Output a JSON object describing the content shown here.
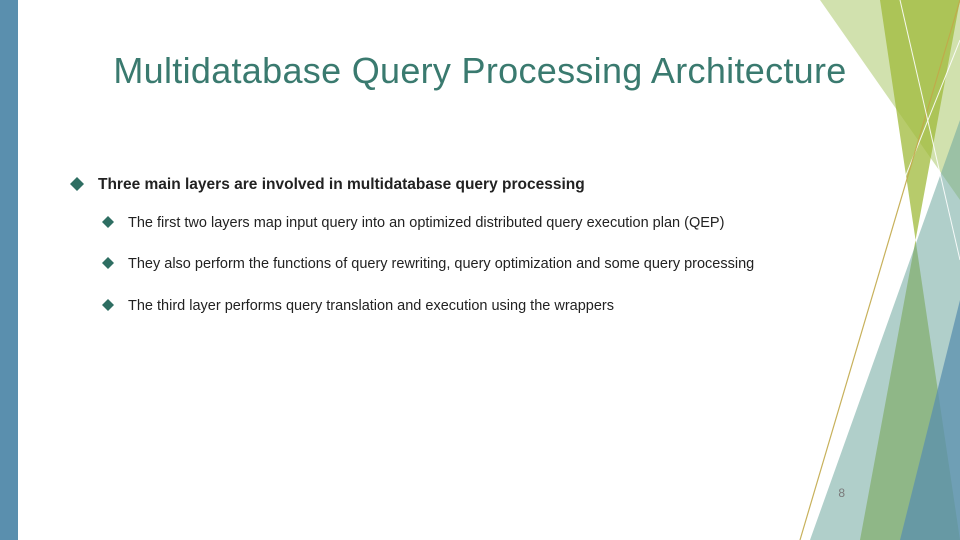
{
  "colors": {
    "accent_title": "#3a7a6f",
    "bullet": "#2e6e62",
    "left_bar": "#5a8fae",
    "deco_olive": "#9fb93a",
    "deco_lightgreen": "#c9dca0",
    "deco_teal": "#6fa79e",
    "deco_blue": "#5a8fae",
    "deco_gold": "#c2a94a"
  },
  "title": "Multidatabase Query Processing Architecture",
  "points": {
    "main": "Three main layers are involved in multidatabase query processing",
    "sub1": "The first two layers map input query into an optimized distributed query execution plan (QEP)",
    "sub2": "They also perform the functions of query rewriting, query optimization and some query processing",
    "sub3": "The third layer performs query translation and execution using the wrappers"
  },
  "page_number": "8"
}
